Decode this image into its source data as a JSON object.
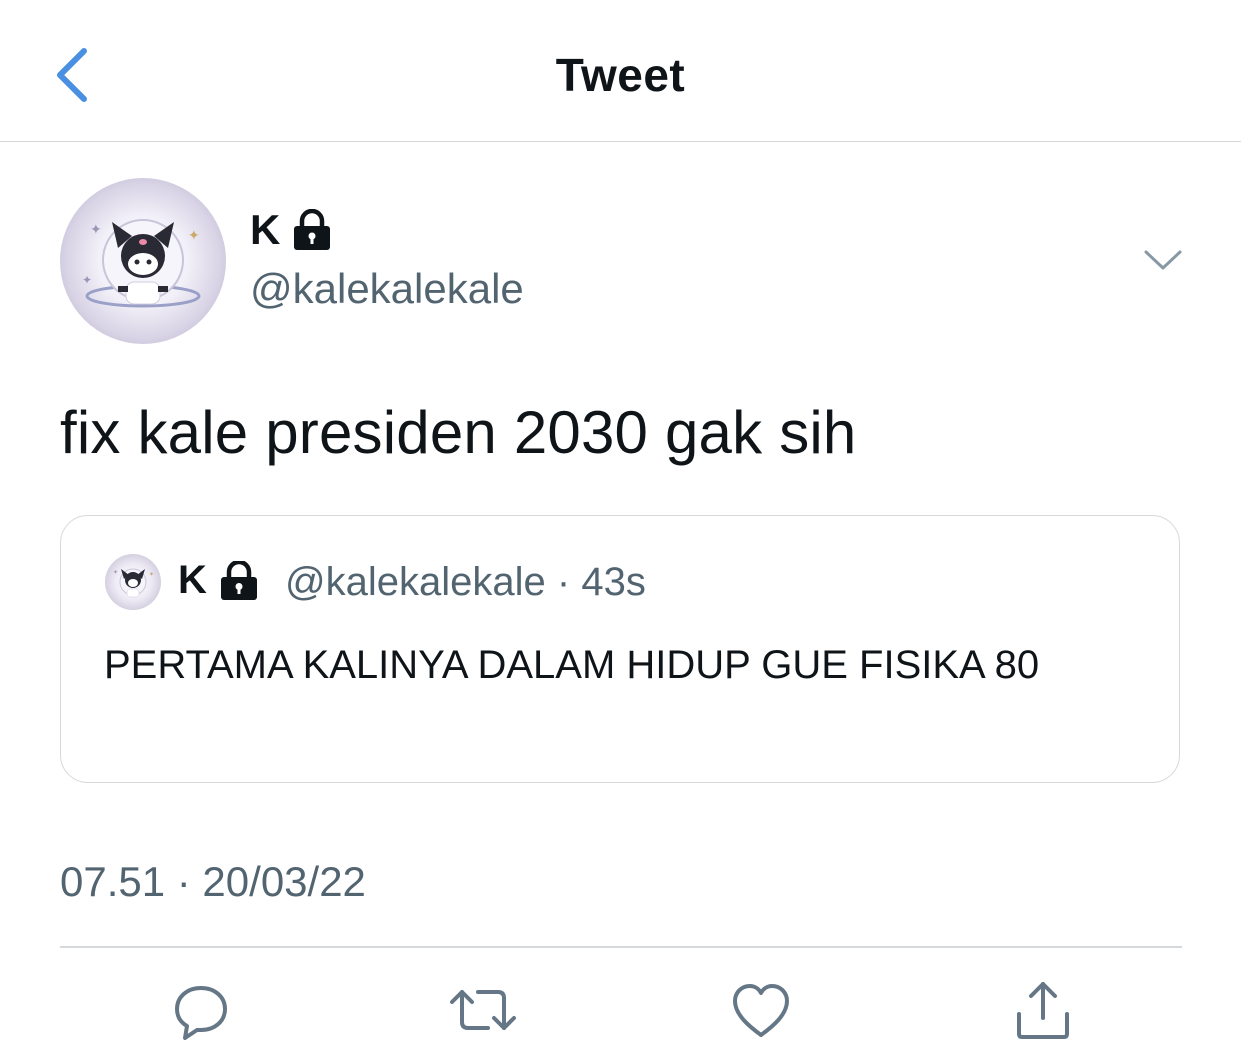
{
  "header": {
    "title": "Tweet",
    "back_icon": "chevron-left-icon",
    "accent_color": "#4a90e2"
  },
  "tweet": {
    "author_name": "K",
    "author_handle": "@kalekalekale",
    "protected_icon": "lock-icon",
    "text": "fix kale presiden 2030 gak sih",
    "timestamp": "07.51 · 20/03/22",
    "menu_icon": "chevron-down-icon"
  },
  "quote": {
    "author_name": "K",
    "author_handle": "@kalekalekale",
    "separator": "·",
    "age": "43s",
    "text": "PERTAMA KALINYA DALAM HIDUP GUE FISIKA 80"
  },
  "actions": {
    "reply_icon": "reply-icon",
    "retweet_icon": "retweet-icon",
    "like_icon": "heart-icon",
    "share_icon": "share-icon",
    "icon_color": "#657786"
  },
  "colors": {
    "text_primary": "#0f1419",
    "text_secondary": "#536471",
    "border": "#d6d9dc"
  }
}
